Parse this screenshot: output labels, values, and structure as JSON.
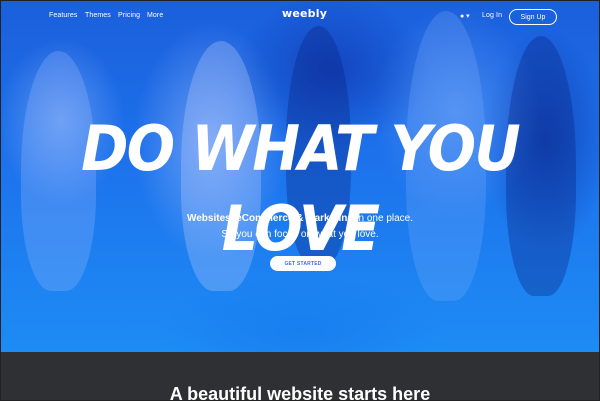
{
  "nav": {
    "links": [
      "Features",
      "Themes",
      "Pricing",
      "More"
    ],
    "logo": "weebly",
    "globe_icon": "globe-icon",
    "globe_symbol": "● ▾",
    "login": "Log In",
    "signup": "Sign Up"
  },
  "hero": {
    "headline": "DO WHAT YOU LOVE",
    "sub_bold": "Websites, eCommerce & Marketing",
    "sub_rest": " in one place.",
    "sub2": "So you can focus on what you love.",
    "cta": "GET STARTED"
  },
  "section": {
    "title": "A beautiful website starts here"
  },
  "colors": {
    "hero_blue": "#1d72ec",
    "section_dark": "#2f3033",
    "cta_text": "#3b6fe0"
  }
}
